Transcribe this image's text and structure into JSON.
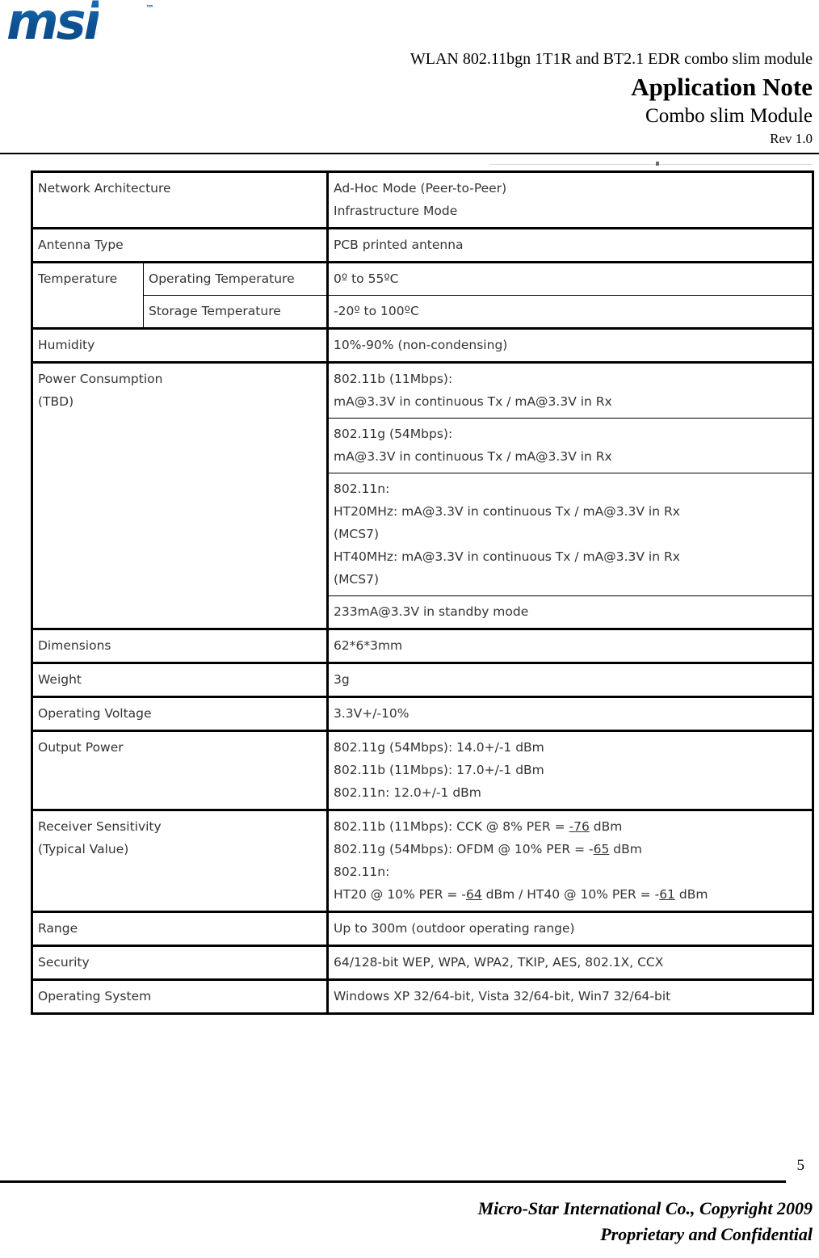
{
  "brand": {
    "logo_text": "msi",
    "trademark": "™"
  },
  "header": {
    "product_line": "WLAN 802.11bgn 1T1R and BT2.1 EDR combo slim module",
    "title": "Application Note",
    "subtitle": "Combo slim Module",
    "revision": "Rev 1.0"
  },
  "spec_table": {
    "network_architecture": {
      "label": "Network Architecture",
      "value_line1": "Ad-Hoc Mode (Peer-to-Peer)",
      "value_line2": "Infrastructure Mode"
    },
    "antenna_type": {
      "label": "Antenna Type",
      "value": "PCB printed antenna"
    },
    "temperature": {
      "label": "Temperature",
      "operating_label": "Operating Temperature",
      "operating_value": "0º to 55ºC",
      "storage_label": "Storage Temperature",
      "storage_value": "-20º to 100ºC"
    },
    "humidity": {
      "label": "Humidity",
      "value": "10%-90% (non-condensing)"
    },
    "power_consumption": {
      "label_line1": "Power Consumption",
      "label_line2": "(TBD)",
      "b_line1": "802.11b (11Mbps):",
      "b_line2": "mA@3.3V in continuous Tx / mA@3.3V in Rx",
      "g_line1": "802.11g (54Mbps):",
      "g_line2": "mA@3.3V in continuous Tx / mA@3.3V in Rx",
      "n_line1": "802.11n:",
      "n_line2": "HT20MHz: mA@3.3V in continuous Tx / mA@3.3V in Rx",
      "n_line3": " (MCS7)",
      "n_line4": "HT40MHz: mA@3.3V in continuous Tx / mA@3.3V in Rx",
      "n_line5": " (MCS7)",
      "standby": "233mA@3.3V in standby mode"
    },
    "dimensions": {
      "label": "Dimensions",
      "value": "62*6*3mm"
    },
    "weight": {
      "label": "Weight",
      "value": "3g"
    },
    "operating_voltage": {
      "label": "Operating Voltage",
      "value": "3.3V+/-10%"
    },
    "output_power": {
      "label": "Output Power",
      "line1": "802.11g (54Mbps): 14.0+/-1 dBm",
      "line2": "802.11b (11Mbps): 17.0+/-1 dBm",
      "line3": "802.11n: 12.0+/-1 dBm"
    },
    "receiver_sensitivity": {
      "label_line1": "Receiver Sensitivity",
      "label_line2": "(Typical Value)",
      "line1_prefix": "802.11b (11Mbps): CCK @ 8% PER = ",
      "line1_value": "-76",
      "line1_suffix": " dBm",
      "line2_prefix": "802.11g (54Mbps): OFDM @ 10% PER = -",
      "line2_value": "65",
      "line2_suffix": " dBm",
      "line3": "802.11n:",
      "line4_prefix": "HT20 @ 10% PER = -",
      "line4_value": "64",
      "line4_mid": " dBm / HT40 @ 10% PER = -",
      "line4_value2": "61",
      "line4_suffix": " dBm"
    },
    "range": {
      "label": "Range",
      "value": "Up to 300m (outdoor operating range)"
    },
    "security": {
      "label": "Security",
      "value": "64/128-bit WEP, WPA, WPA2, TKIP, AES, 802.1X, CCX"
    },
    "operating_system": {
      "label": "Operating System",
      "value": "Windows XP 32/64-bit, Vista 32/64-bit, Win7 32/64-bit"
    }
  },
  "footer": {
    "page_number": "5",
    "company_line": "Micro-Star International Co., Copyright 2009",
    "confidential_line": "Proprietary and Confidential"
  }
}
